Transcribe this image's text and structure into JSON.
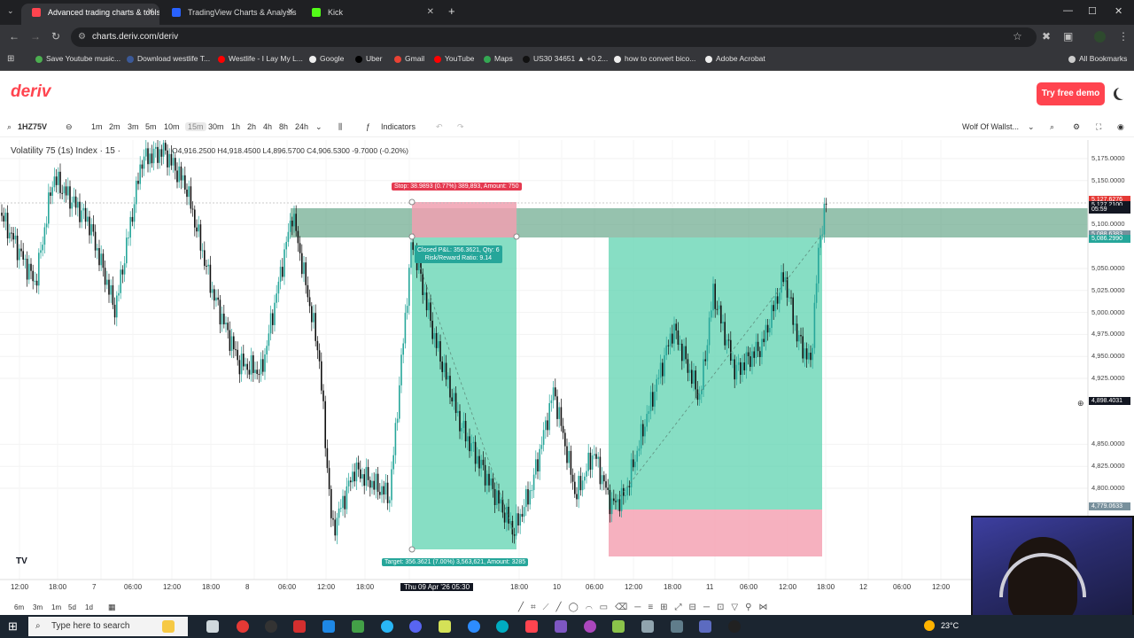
{
  "browser": {
    "tabs": [
      {
        "title": "Advanced trading charts & tools",
        "active": true,
        "favicon_color": "#ff444f"
      },
      {
        "title": "TradingView Charts & Analysis",
        "active": false,
        "favicon_color": "#2962ff"
      },
      {
        "title": "Kick",
        "active": false,
        "favicon_color": "#53fc18"
      }
    ],
    "new_tab_label": "+",
    "url": "charts.deriv.com/deriv",
    "bookmarks": [
      {
        "label": "Save Youtube music...",
        "color": "#4caf50"
      },
      {
        "label": "Download westlife T...",
        "color": "#3b5998"
      },
      {
        "label": "Westlife - I Lay My L...",
        "color": "#ff0000"
      },
      {
        "label": "Google",
        "color": "#eeeeee"
      },
      {
        "label": "Uber",
        "color": "#000000"
      },
      {
        "label": "Gmail",
        "color": "#ea4335"
      },
      {
        "label": "YouTube",
        "color": "#ff0000"
      },
      {
        "label": "Maps",
        "color": "#34a853"
      },
      {
        "label": "US30 34651 ▲ +0.2...",
        "color": "#111111"
      },
      {
        "label": "how to convert bico...",
        "color": "#eeeeee"
      },
      {
        "label": "Adobe Acrobat",
        "color": "#eeeeee"
      }
    ],
    "all_bookmarks_label": "All Bookmarks"
  },
  "deriv": {
    "logo": "deriv",
    "demo_button": "Try free demo"
  },
  "toolbar": {
    "symbol": "1HZ75V",
    "timeframes": [
      "1m",
      "2m",
      "3m",
      "5m",
      "10m",
      "15m",
      "30m",
      "1h",
      "2h",
      "4h",
      "8h",
      "24h"
    ],
    "active_timeframe": "15m",
    "indicators_label": "Indicators",
    "layout_name": "Wolf Of Wallst..."
  },
  "chart": {
    "title": "Volatility 75 (1s) Index · 15 ·",
    "ohlc": "O4,916.2500 H4,918.4500 L4,896.5700 C4,906.5300 -9.7000 (-0.20%)",
    "y_labels": [
      {
        "text": "5,175.0000",
        "v": 5175
      },
      {
        "text": "5,150.0000",
        "v": 5150
      },
      {
        "text": "5,100.0000",
        "v": 5100
      },
      {
        "text": "5,050.0000",
        "v": 5050
      },
      {
        "text": "5,025.0000",
        "v": 5025
      },
      {
        "text": "5,000.0000",
        "v": 5000
      },
      {
        "text": "4,975.0000",
        "v": 4975
      },
      {
        "text": "4,950.0000",
        "v": 4950
      },
      {
        "text": "4,925.0000",
        "v": 4925
      },
      {
        "text": "4,850.0000",
        "v": 4850
      },
      {
        "text": "4,825.0000",
        "v": 4825
      },
      {
        "text": "4,800.0000",
        "v": 4800
      }
    ],
    "price_tags": [
      {
        "text": "5,127.6276",
        "v": 5127.6,
        "color": "#e53935"
      },
      {
        "text": "5,127.2100",
        "v": 5122.0,
        "color": "#131722"
      },
      {
        "text": "05:59",
        "v": 5117.0,
        "color": "#131722"
      },
      {
        "text": "5,088.6383",
        "v": 5088.6,
        "color": "#78909c"
      },
      {
        "text": "5,086.2990",
        "v": 5083.0,
        "color": "#26a69a"
      },
      {
        "text": "4,898.4031",
        "v": 4898.4,
        "color": "#131722"
      },
      {
        "text": "4,779.0633",
        "v": 4779.1,
        "color": "#78909c"
      }
    ],
    "x_labels": [
      "12:00",
      "18:00",
      "7",
      "06:00",
      "12:00",
      "18:00",
      "8",
      "06:00",
      "12:00",
      "18:00",
      "Thu 09 Apr '26  05:30",
      "18:00",
      "10",
      "06:00",
      "12:00",
      "18:00",
      "11",
      "06:00",
      "12:00",
      "18:00",
      "12",
      "06:00",
      "12:00"
    ],
    "stop_label": "Stop: 38.9893 (0.77%) 389,893, Amount: 750",
    "closed_label_1": "Closed P&L: 356.3621, Qty: 6",
    "closed_label_2": "Risk/Reward Ratio: 9.14",
    "target_label": "Target: 356.3621 (7.00%) 3,563,621, Amount: 3285",
    "bottom_ranges": [
      "6m",
      "3m",
      "1m",
      "5d",
      "1d"
    ]
  },
  "taskbar": {
    "search_placeholder": "Type here to search",
    "weather": "23°C"
  },
  "colors": {
    "up": "#26a69a",
    "down": "#111111",
    "profit_zone": "#5fd3b0",
    "loss_zone": "#f5a9b8"
  }
}
